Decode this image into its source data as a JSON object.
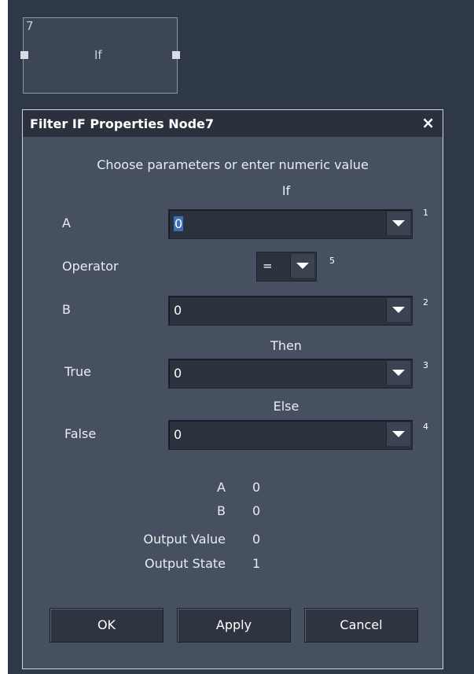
{
  "node": {
    "id": "7",
    "title": "If"
  },
  "dialog": {
    "title": "Filter IF Properties Node7",
    "close_glyph": "×",
    "instructions": "Choose parameters or enter numeric value",
    "sections": {
      "if": "If",
      "then": "Then",
      "else": "Else"
    },
    "fields": {
      "a": {
        "label": "A",
        "value": "0",
        "index": "1"
      },
      "operator": {
        "label": "Operator",
        "value": "=",
        "index": "5"
      },
      "b": {
        "label": "B",
        "value": "0",
        "index": "2"
      },
      "true": {
        "label": "True",
        "value": "0",
        "index": "3"
      },
      "false": {
        "label": "False",
        "value": "0",
        "index": "4"
      }
    },
    "summary": {
      "a": {
        "label": "A",
        "value": "0"
      },
      "b": {
        "label": "B",
        "value": "0"
      },
      "output_value": {
        "label": "Output Value",
        "value": "0"
      },
      "output_state": {
        "label": "Output State",
        "value": "1"
      }
    },
    "buttons": {
      "ok": "OK",
      "apply": "Apply",
      "cancel": "Cancel"
    }
  },
  "icons": {
    "combo_arrow": "chevron-down-icon",
    "close": "close-icon"
  }
}
